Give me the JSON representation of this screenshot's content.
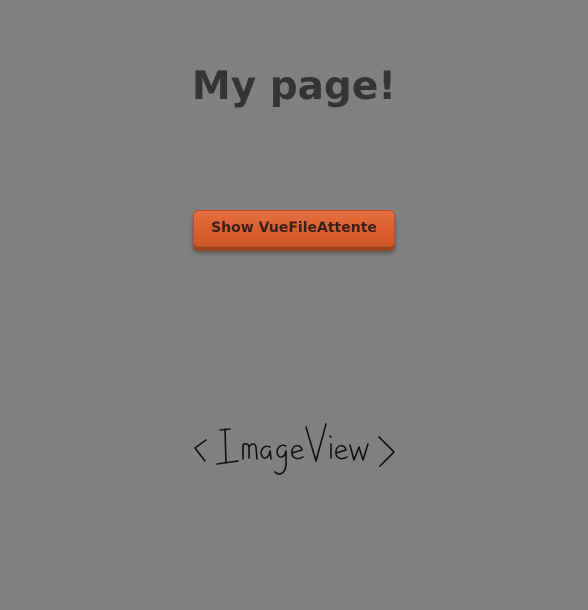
{
  "page": {
    "title": "My page!",
    "background_color": "#808080"
  },
  "actions": {
    "show_button_label": "Show VueFileAttente",
    "button_color": "#d95f31"
  },
  "image_view": {
    "handwritten_text": "<ImageView>",
    "icon": "handwritten-placeholder-icon"
  }
}
